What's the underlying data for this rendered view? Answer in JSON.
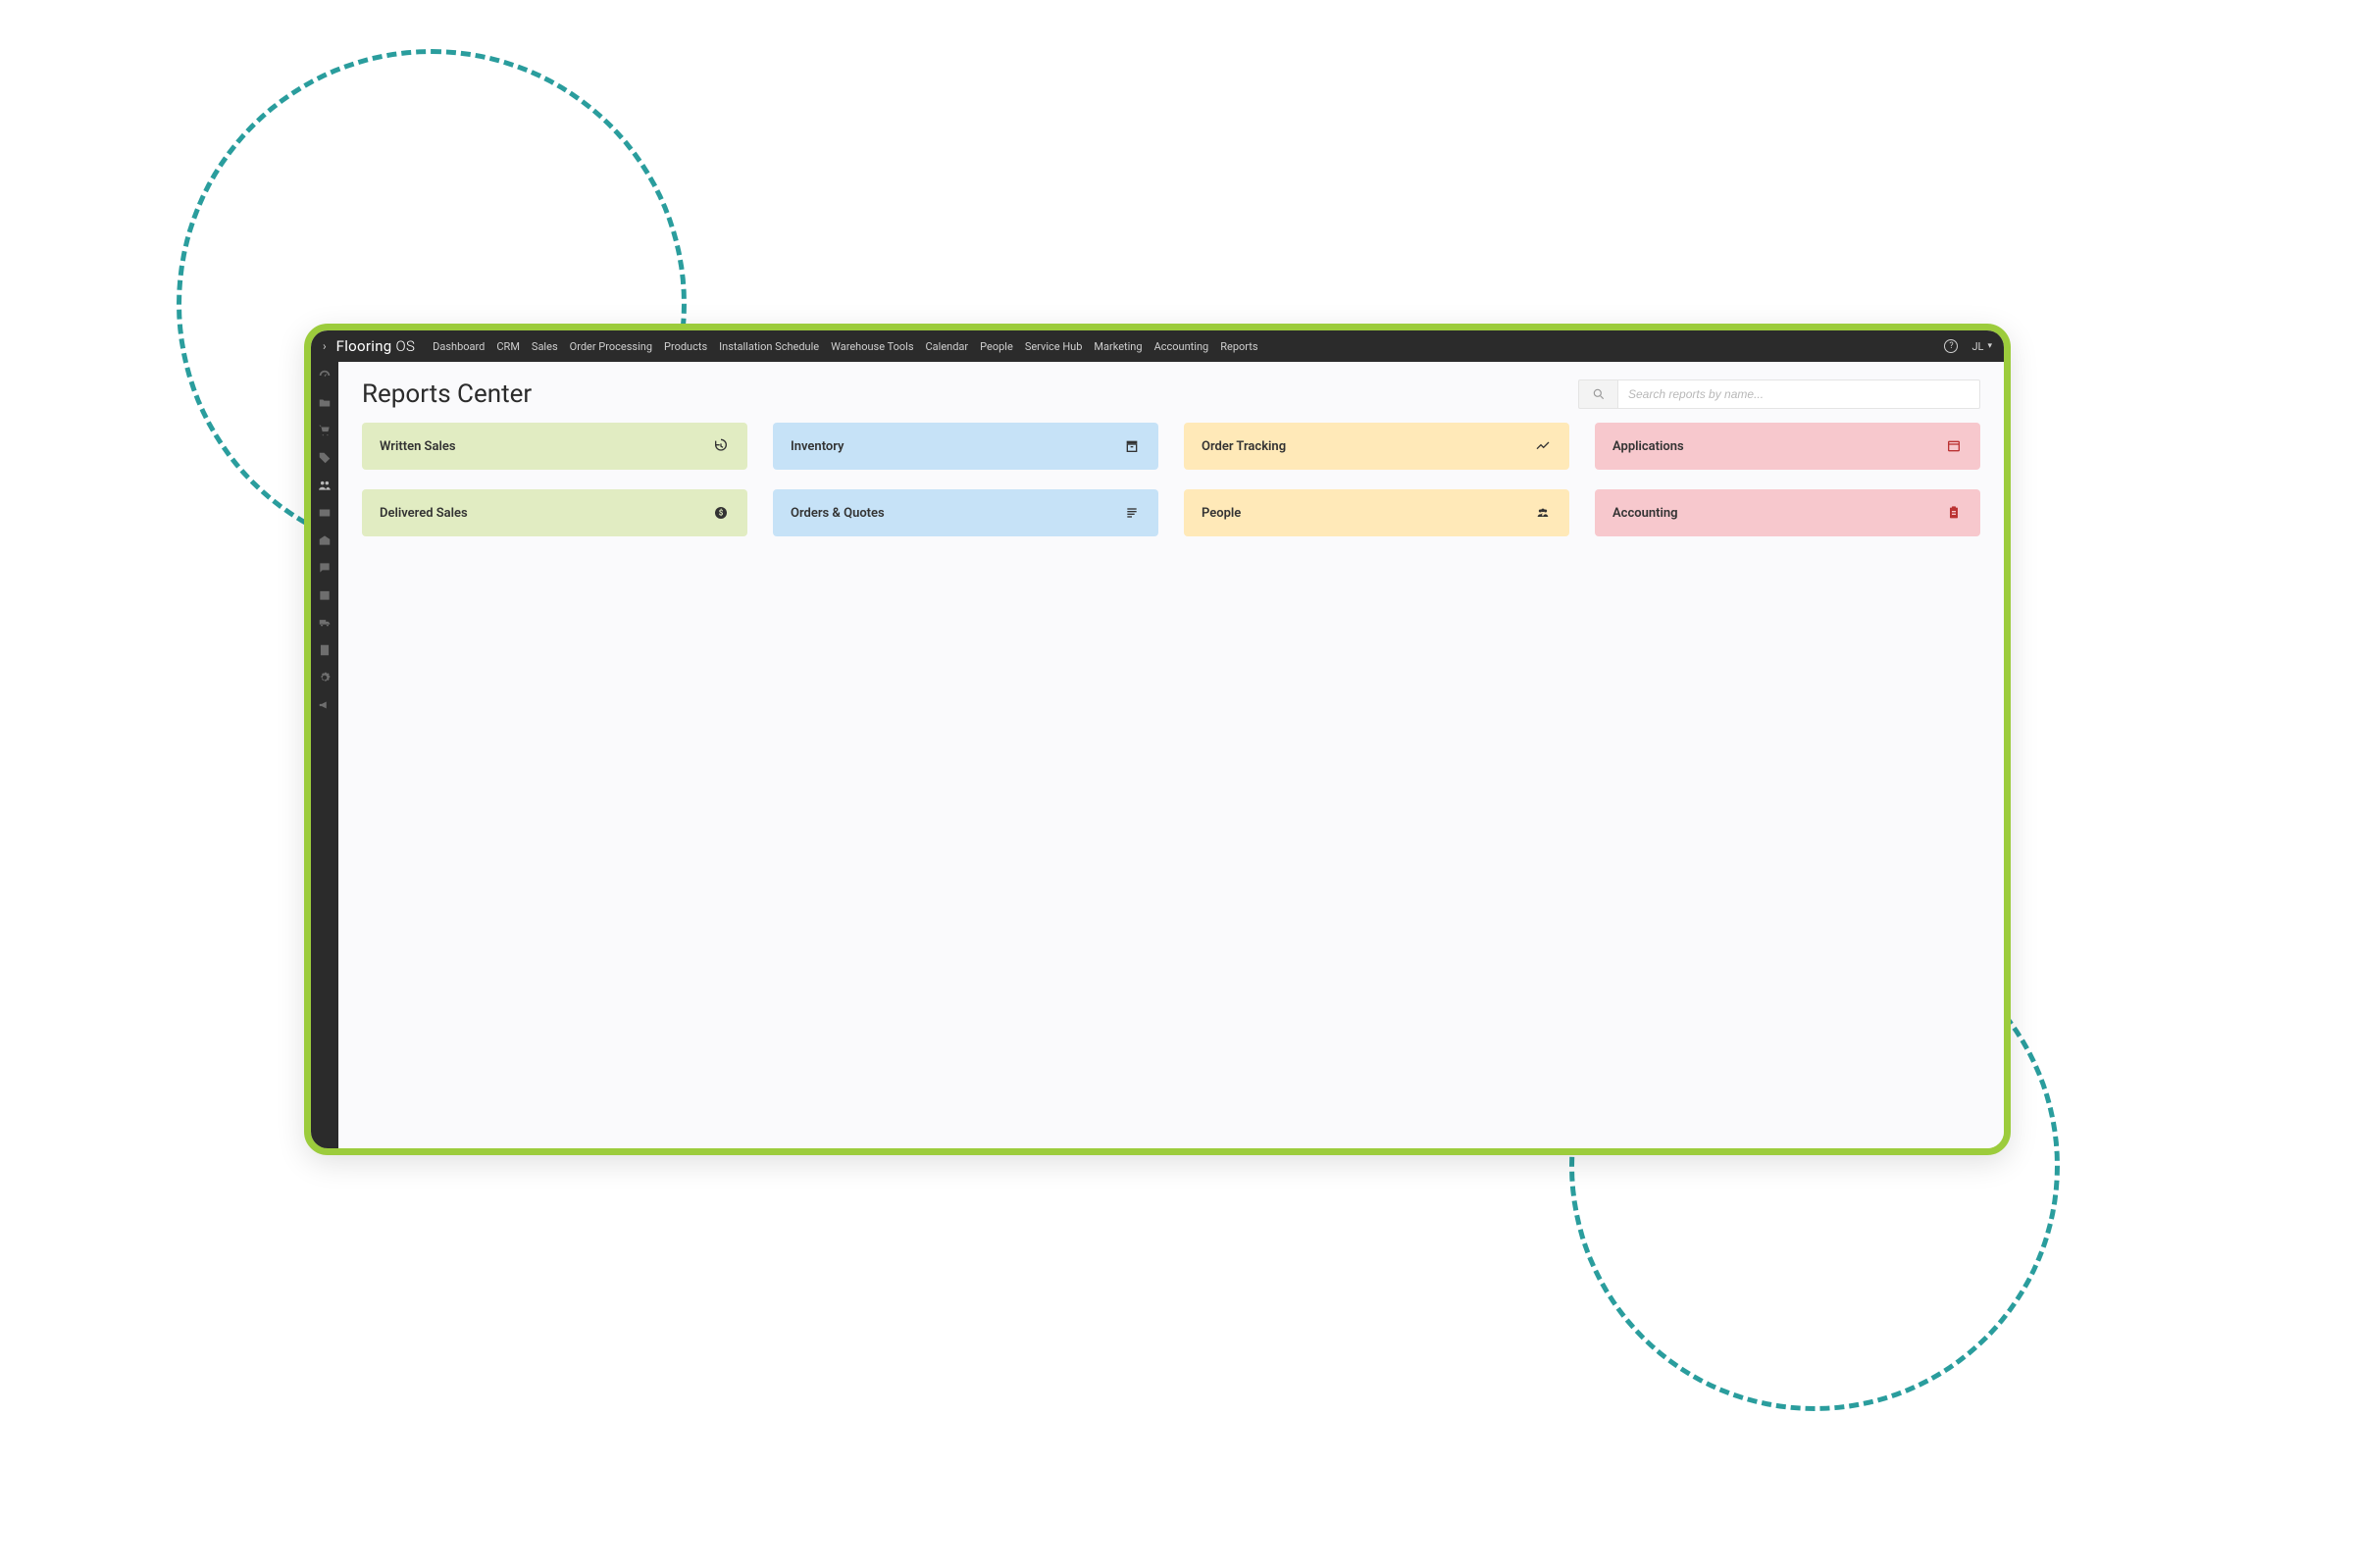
{
  "brand": {
    "name_a": "Flooring ",
    "name_b": "OS"
  },
  "nav": {
    "items": [
      "Dashboard",
      "CRM",
      "Sales",
      "Order Processing",
      "Products",
      "Installation Schedule",
      "Warehouse Tools",
      "Calendar",
      "People",
      "Service Hub",
      "Marketing",
      "Accounting",
      "Reports"
    ]
  },
  "user": {
    "initials": "JL"
  },
  "sidebar": {
    "icons": [
      "gauge-icon",
      "folder-icon",
      "cart-icon",
      "tags-icon",
      "people-icon",
      "card-icon",
      "warehouse-icon",
      "chat-icon",
      "calendar-icon",
      "truck-icon",
      "report-icon",
      "settings-icon",
      "megaphone-icon"
    ]
  },
  "page": {
    "title": "Reports Center"
  },
  "search": {
    "placeholder": "Search reports by name..."
  },
  "cards": [
    {
      "label": "Written Sales",
      "color": "c-green",
      "icon": "history-icon"
    },
    {
      "label": "Inventory",
      "color": "c-blue",
      "icon": "archive-icon"
    },
    {
      "label": "Order Tracking",
      "color": "c-yellow",
      "icon": "trend-icon"
    },
    {
      "label": "Applications",
      "color": "c-pink",
      "icon": "window-icon"
    },
    {
      "label": "Delivered Sales",
      "color": "c-green",
      "icon": "dollar-icon"
    },
    {
      "label": "Orders & Quotes",
      "color": "c-blue",
      "icon": "list-icon"
    },
    {
      "label": "People",
      "color": "c-yellow",
      "icon": "group-icon"
    },
    {
      "label": "Accounting",
      "color": "c-pink",
      "icon": "clipboard-icon"
    }
  ],
  "colors": {
    "frame_border": "#9ccc3c",
    "deco_teal": "#2a9d9d",
    "navbar_bg": "#2b2b2b",
    "green": "#e1ecc2",
    "blue": "#c6e2f7",
    "yellow": "#ffe9b8",
    "pink": "#f7c8cd"
  }
}
